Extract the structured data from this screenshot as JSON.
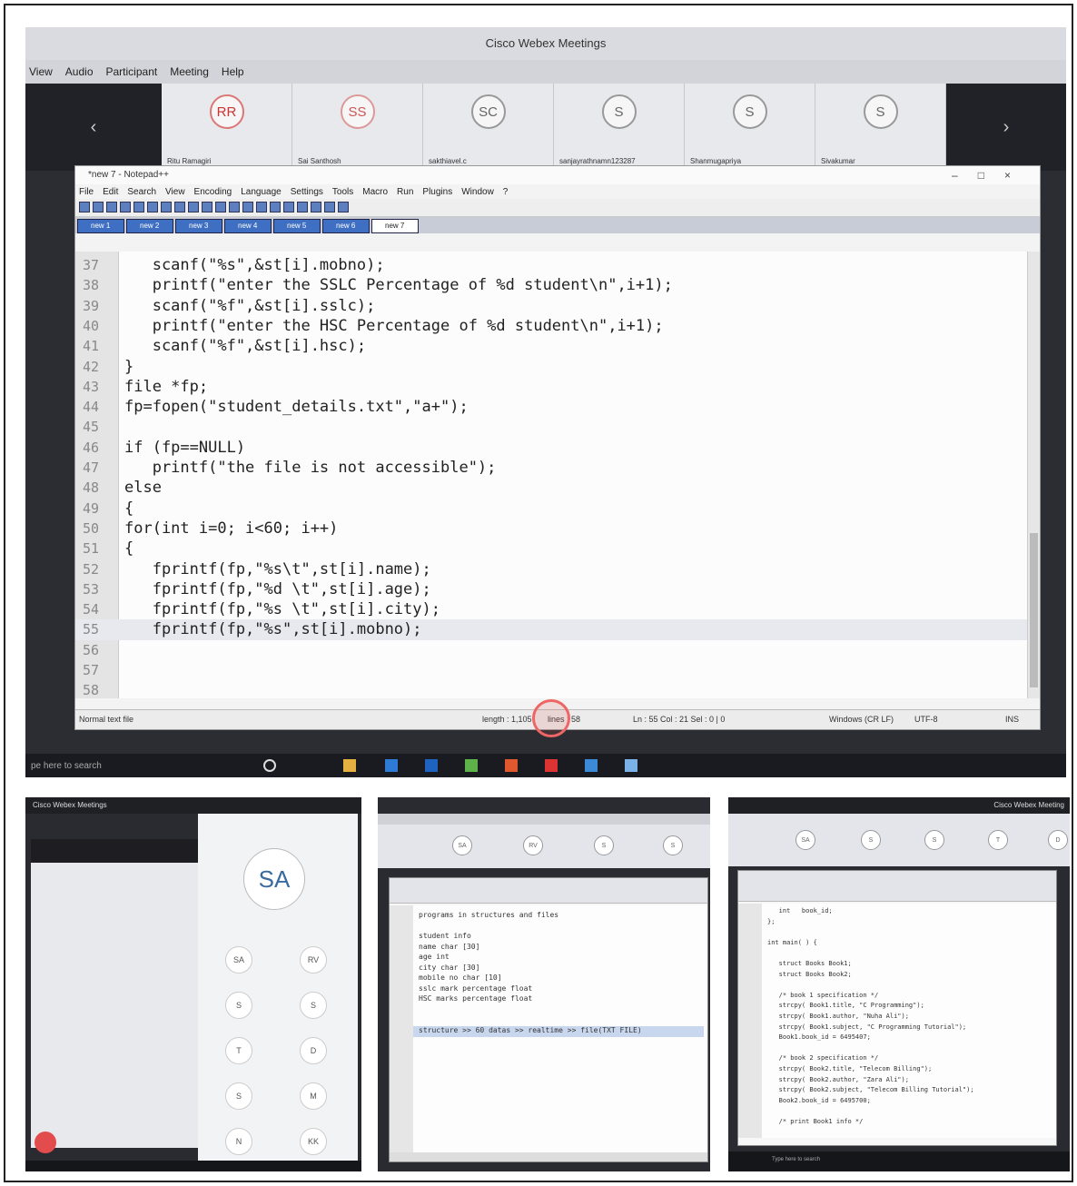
{
  "webex": {
    "title": "Cisco Webex Meetings",
    "menu": [
      "View",
      "Audio",
      "Participant",
      "Meeting",
      "Help"
    ],
    "participants": [
      {
        "initials": "RR",
        "name": "Ritu Ramagiri"
      },
      {
        "initials": "SS",
        "name": "Sai Santhosh"
      },
      {
        "initials": "SC",
        "name": "sakthiavel.c"
      },
      {
        "initials": "S",
        "name": "sanjayrathnamn123287"
      },
      {
        "initials": "S",
        "name": "Shanmugapriya"
      },
      {
        "initials": "S",
        "name": "Sivakumar"
      }
    ],
    "prev_arrow": "‹",
    "next_arrow": "›"
  },
  "notepad": {
    "title": "*new 7 - Notepad++",
    "menu": [
      "File",
      "Edit",
      "Search",
      "View",
      "Encoding",
      "Language",
      "Settings",
      "Tools",
      "Macro",
      "Run",
      "Plugins",
      "Window",
      "?"
    ],
    "tabs": [
      "new 1",
      "new 2",
      "new 3",
      "new 4",
      "new 5",
      "new 6",
      "new 7"
    ],
    "lines": [
      {
        "n": "37",
        "code": "   scanf(\"%s\",&st[i].mobno);"
      },
      {
        "n": "38",
        "code": "   printf(\"enter the SSLC Percentage of %d student\\n\",i+1);"
      },
      {
        "n": "39",
        "code": "   scanf(\"%f\",&st[i].sslc);"
      },
      {
        "n": "40",
        "code": "   printf(\"enter the HSC Percentage of %d student\\n\",i+1);"
      },
      {
        "n": "41",
        "code": "   scanf(\"%f\",&st[i].hsc);"
      },
      {
        "n": "42",
        "code": "}"
      },
      {
        "n": "43",
        "code": "file *fp;"
      },
      {
        "n": "44",
        "code": "fp=fopen(\"student_details.txt\",\"a+\");"
      },
      {
        "n": "45",
        "code": ""
      },
      {
        "n": "46",
        "code": "if (fp==NULL)"
      },
      {
        "n": "47",
        "code": "   printf(\"the file is not accessible\");"
      },
      {
        "n": "48",
        "code": "else"
      },
      {
        "n": "49",
        "code": "{"
      },
      {
        "n": "50",
        "code": "for(int i=0; i<60; i++)"
      },
      {
        "n": "51",
        "code": "{"
      },
      {
        "n": "52",
        "code": "   fprintf(fp,\"%s\\t\",st[i].name);"
      },
      {
        "n": "53",
        "code": "   fprintf(fp,\"%d \\t\",st[i].age);"
      },
      {
        "n": "54",
        "code": "   fprintf(fp,\"%s \\t\",st[i].city);"
      },
      {
        "n": "55",
        "code": "   fprintf(fp,\"%s\",st[i].mobno);"
      },
      {
        "n": "56",
        "code": ""
      },
      {
        "n": "57",
        "code": ""
      },
      {
        "n": "58",
        "code": ""
      }
    ],
    "highlighted_line": "55",
    "status": {
      "file_type": "Normal text file",
      "length": "length : 1,105",
      "lines": "lines : 58",
      "position": "Ln : 55   Col : 21   Sel : 0 | 0",
      "eol": "Windows (CR LF)",
      "encoding": "UTF-8",
      "mode": "INS"
    }
  },
  "taskbar": {
    "search": "pe here to search"
  },
  "thumb1": {
    "title": "Cisco Webex Meetings",
    "big_avatar": "SA",
    "avatars": [
      "SA",
      "RV",
      "S",
      "S",
      "T",
      "D",
      "S",
      "M",
      "N",
      "KK"
    ]
  },
  "thumb2": {
    "avatars": [
      "SA",
      "RV",
      "S",
      "S"
    ],
    "lines": [
      "programs in structures and files",
      "",
      "student info",
      "name char [30]",
      "age int",
      "city char [30]",
      "mobile no char [10]",
      "sslc mark percentage float",
      "HSC marks percentage float",
      "",
      "",
      "structure >> 60 datas >> realtime >> file(TXT FILE)"
    ],
    "highlighted_index": 11
  },
  "thumb3": {
    "title": "Cisco Webex Meeting",
    "avatars": [
      "SA",
      "S",
      "S",
      "T",
      "D"
    ],
    "lines": [
      "   int   book_id;",
      "};",
      "",
      "int main( ) {",
      "",
      "   struct Books Book1;",
      "   struct Books Book2;",
      "",
      "   /* book 1 specification */",
      "   strcpy( Book1.title, \"C Programming\");",
      "   strcpy( Book1.author, \"Nuha Ali\");",
      "   strcpy( Book1.subject, \"C Programming Tutorial\");",
      "   Book1.book_id = 6495407;",
      "",
      "   /* book 2 specification */",
      "   strcpy( Book2.title, \"Telecom Billing\");",
      "   strcpy( Book2.author, \"Zara Ali\");",
      "   strcpy( Book2.subject, \"Telecom Billing Tutorial\");",
      "   Book2.book_id = 6495700;",
      "",
      "   /* print Book1 info */"
    ],
    "search": "Type here to search"
  }
}
